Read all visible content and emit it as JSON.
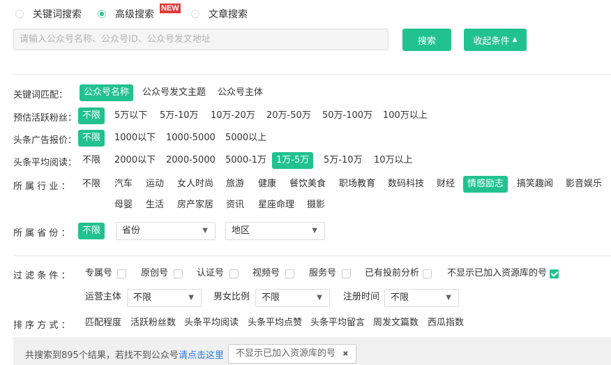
{
  "search_modes": [
    {
      "label": "关键词搜索",
      "selected": false
    },
    {
      "label": "高级搜索",
      "selected": true,
      "badge": "NEW"
    },
    {
      "label": "文章搜索",
      "selected": false
    }
  ],
  "search": {
    "placeholder": "请输入公众号名称、公众号ID、公众号发文地址",
    "button": "搜索",
    "collapse_button": "收起条件"
  },
  "filters": {
    "keyword_match": {
      "label": "关键词匹配：",
      "options": [
        "公众号名称",
        "公众号发文主题",
        "公众号主体"
      ],
      "selected": 0
    },
    "fans": {
      "label": "预估活跃粉丝：",
      "options": [
        "不限",
        "5万以下",
        "5万-10万",
        "10万-20万",
        "20万-50万",
        "50万-100万",
        "100万以上"
      ],
      "selected": 0
    },
    "ad_price": {
      "label": "头条广告报价：",
      "options": [
        "不限",
        "1000以下",
        "1000-5000",
        "5000以上"
      ],
      "selected": 0
    },
    "avg_read": {
      "label": "头条平均阅读：",
      "options": [
        "不限",
        "2000以下",
        "2000-5000",
        "5000-1万",
        "1万-5万",
        "5万-10万",
        "10万以上"
      ],
      "selected": 4
    },
    "industry": {
      "label": "所 属 行 业 ：",
      "options": [
        "不限",
        "汽车",
        "运动",
        "女人时尚",
        "旅游",
        "健康",
        "餐饮美食",
        "职场教育",
        "数码科技",
        "财经",
        "情感励志",
        "搞笑趣闻",
        "影音娱乐",
        "母婴",
        "生活",
        "房产家居",
        "资讯",
        "星座命理",
        "摄影"
      ],
      "selected": 10
    },
    "province": {
      "label": "所 属 省 份 ：",
      "all": "不限",
      "province_select": "省份",
      "region_select": "地区"
    }
  },
  "filter_conditions": {
    "label": "过 滤 条 件 ：",
    "checkboxes": [
      {
        "label": "专属号",
        "checked": false
      },
      {
        "label": "原创号",
        "checked": false
      },
      {
        "label": "认证号",
        "checked": false
      },
      {
        "label": "视频号",
        "checked": false
      },
      {
        "label": "服务号",
        "checked": false
      },
      {
        "label": "已有投前分析",
        "checked": false
      },
      {
        "label": "不显示已加入资源库的号",
        "checked": true
      }
    ],
    "operator": {
      "label": "运营主体",
      "value": "不限"
    },
    "gender": {
      "label": "男女比例",
      "value": "不限"
    },
    "register": {
      "label": "注册时间",
      "value": "不限"
    }
  },
  "sort": {
    "label": "排 序 方 式 ：",
    "options": [
      "匹配程度",
      "活跃粉丝数",
      "头条平均阅读",
      "头条平均点赞",
      "头条平均留言",
      "周发文篇数",
      "西瓜指数"
    ]
  },
  "result": {
    "text": "共搜索到895个结果，若找不到公众号",
    "link": "请点击这里",
    "tag": "不显示已加入资源库的号",
    "tag_close": "✖"
  },
  "colors": {
    "accent": "#21c28e",
    "badge": "#e03a3a",
    "link": "#2a7ae2"
  }
}
